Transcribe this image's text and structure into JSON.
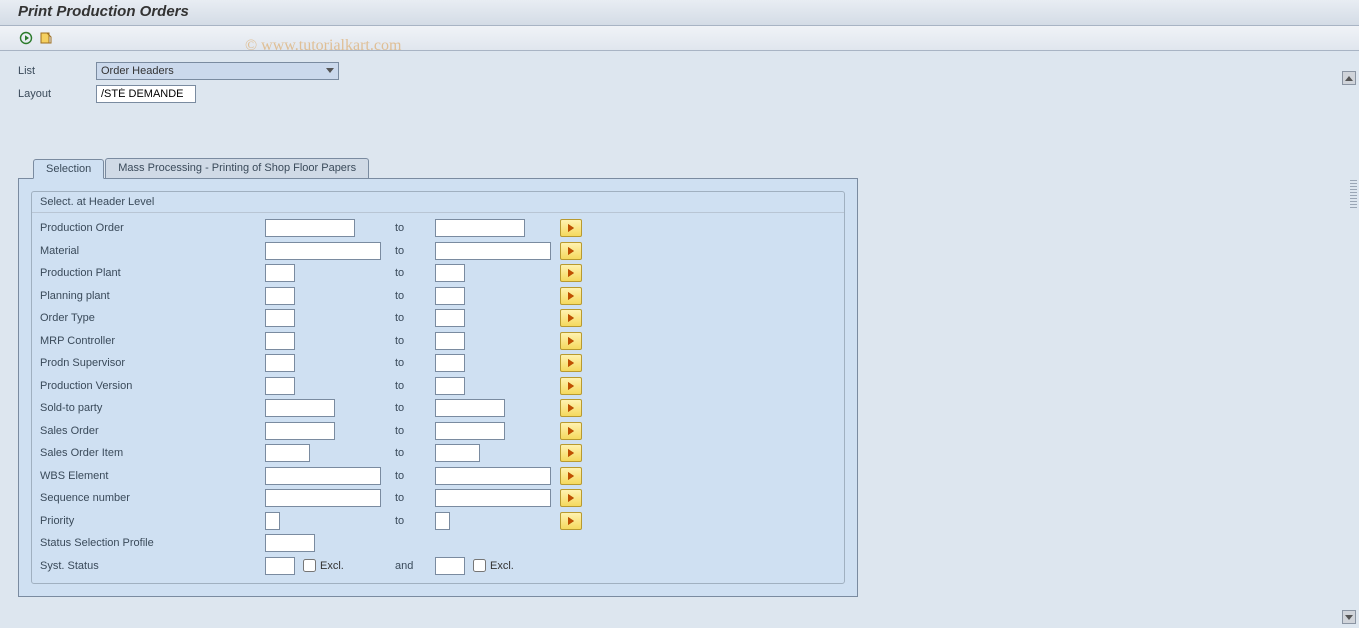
{
  "title": "Print Production Orders",
  "watermark": "© www.tutorialkart.com",
  "top": {
    "list_label": "List",
    "list_value": "Order Headers",
    "layout_label": "Layout",
    "layout_value": "/STÉ DEMANDE"
  },
  "tabs": {
    "selection": "Selection",
    "mass": "Mass Processing - Printing of Shop Floor Papers"
  },
  "group": {
    "title": "Select. at Header Level",
    "to": "to",
    "and": "and",
    "excl": "Excl.",
    "rows": {
      "r0": "Production Order",
      "r1": "Material",
      "r2": "Production Plant",
      "r3": "Planning plant",
      "r4": "Order Type",
      "r5": "MRP Controller",
      "r6": "Prodn Supervisor",
      "r7": "Production Version",
      "r8": "Sold-to party",
      "r9": "Sales Order",
      "r10": "Sales Order Item",
      "r11": "WBS Element",
      "r12": "Sequence number",
      "r13": "Priority",
      "r14": "Status Selection Profile",
      "r15": "Syst. Status"
    }
  }
}
